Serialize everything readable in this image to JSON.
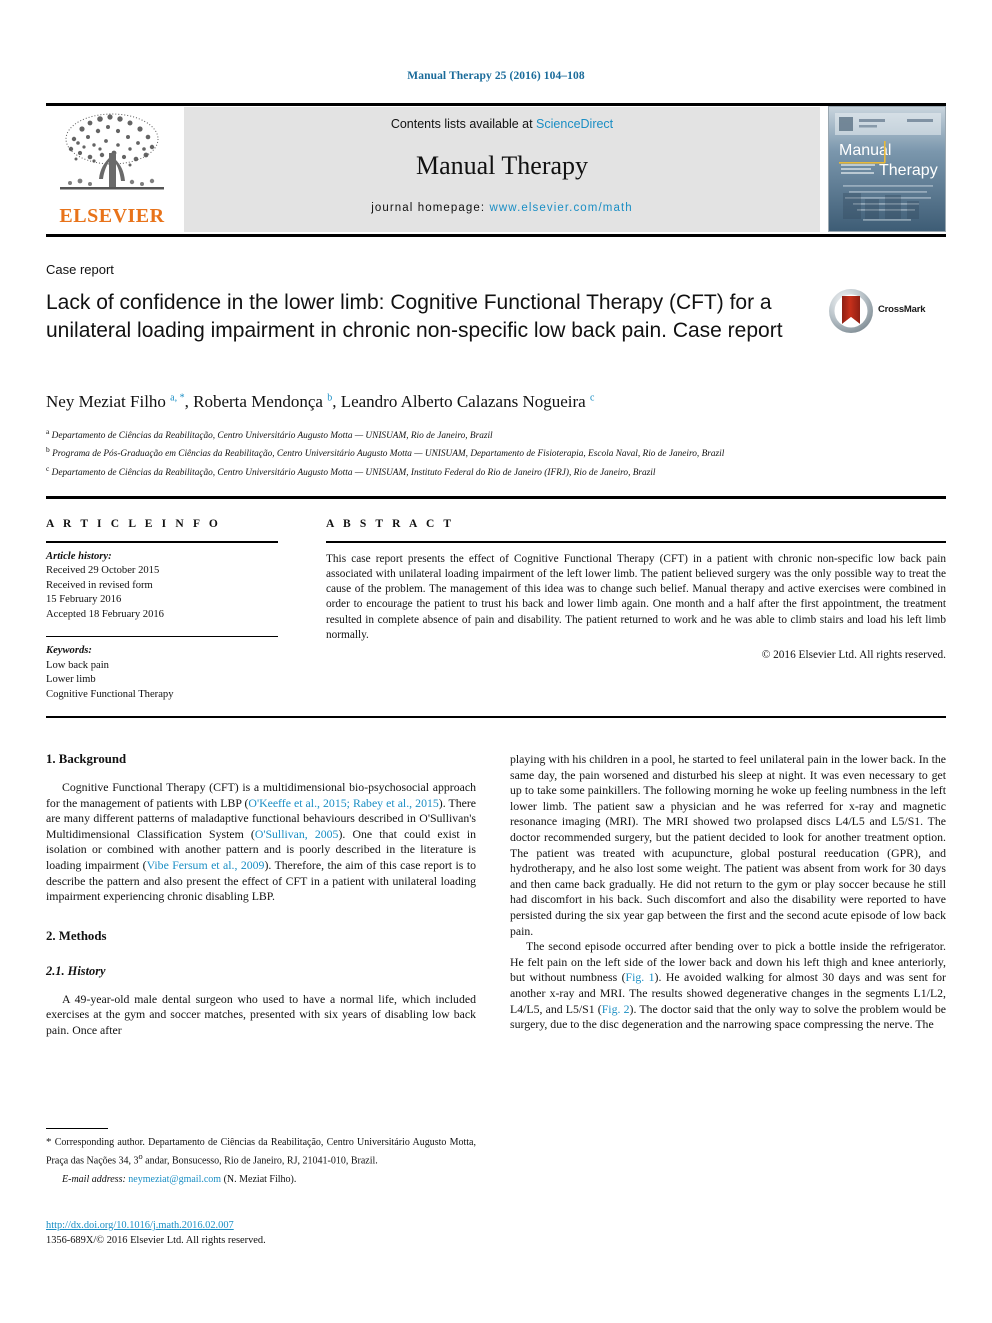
{
  "running_head": "Manual Therapy 25 (2016) 104–108",
  "masthead": {
    "contents_prefix": "Contents lists available at ",
    "sciencedirect": "ScienceDirect",
    "journal_name": "Manual Therapy",
    "homepage_label": "journal homepage: ",
    "homepage_url": "www.elsevier.com/math",
    "publisher": "ELSEVIER",
    "cover_title_line1": "Manual",
    "cover_title_line2": "Therapy"
  },
  "article": {
    "type": "Case report",
    "title": "Lack of confidence in the lower limb: Cognitive Functional Therapy (CFT) for a unilateral loading impairment in chronic non-specific low back pain. Case report",
    "crossmark_label": "CrossMark",
    "authors_html": "Ney Meziat Filho <sup class=\"sup\">a, *</sup>, Roberta Mendonça <sup class=\"sup\">b</sup>, Leandro Alberto Calazans Nogueira <sup class=\"sup\">c</sup>",
    "affiliations": [
      {
        "mark": "a",
        "text": "Departamento de Ciências da Reabilitação, Centro Universitário Augusto Motta — UNISUAM, Rio de Janeiro, Brazil"
      },
      {
        "mark": "b",
        "text": "Programa de Pós-Graduação em Ciências da Reabilitação, Centro Universitário Augusto Motta — UNISUAM, Departamento de Fisioterapia, Escola Naval, Rio de Janeiro, Brazil"
      },
      {
        "mark": "c",
        "text": "Departamento de Ciências da Reabilitação, Centro Universitário Augusto Motta — UNISUAM, Instituto Federal do Rio de Janeiro (IFRJ), Rio de Janeiro, Brazil"
      }
    ]
  },
  "article_info": {
    "heading": "A R T I C L E   I N F O",
    "history_label": "Article history:",
    "history": [
      "Received 29 October 2015",
      "Received in revised form",
      "15 February 2016",
      "Accepted 18 February 2016"
    ],
    "keywords_label": "Keywords:",
    "keywords": [
      "Low back pain",
      "Lower limb",
      "Cognitive Functional Therapy"
    ]
  },
  "abstract": {
    "heading": "A B S T R A C T",
    "text": "This case report presents the effect of Cognitive Functional Therapy (CFT) in a patient with chronic non-specific low back pain associated with unilateral loading impairment of the left lower limb. The patient believed surgery was the only possible way to treat the cause of the problem. The management of this idea was to change such belief. Manual therapy and active exercises were combined in order to encourage the patient to trust his back and lower limb again. One month and a half after the first appointment, the treatment resulted in complete absence of pain and disability. The patient returned to work and he was able to climb stairs and load his left limb normally.",
    "copyright": "© 2016 Elsevier Ltd. All rights reserved."
  },
  "body": {
    "background_heading": "1. Background",
    "background_p1_html": "Cognitive Functional Therapy (CFT) is a multidimensional bio-psychosocial approach for the management of patients with LBP (<span class=\"ref\">O'Keeffe et al., 2015; Rabey et al., 2015</span>). There are many different patterns of maladaptive functional behaviours described in O'Sullivan's Multidimensional Classification System (<span class=\"ref\">O'Sullivan, 2005</span>). One that could exist in isolation or combined with another pattern and is poorly described in the literature is loading impairment (<span class=\"ref\">Vibe Fersum et al., 2009</span>). Therefore, the aim of this case report is to describe the pattern and also present the effect of CFT in a patient with unilateral loading impairment experiencing chronic disabling LBP.",
    "methods_heading": "2. Methods",
    "history_heading": "2.1. History",
    "history_p1": "A 49-year-old male dental surgeon who used to have a normal life, which included exercises at the gym and soccer matches, presented with six years of disabling low back pain. Once after",
    "right_p1": "playing with his children in a pool, he started to feel unilateral pain in the lower back. In the same day, the pain worsened and disturbed his sleep at night. It was even necessary to get up to take some painkillers. The following morning he woke up feeling numbness in the left lower limb. The patient saw a physician and he was referred for x-ray and magnetic resonance imaging (MRI). The MRI showed two prolapsed discs L4/L5 and L5/S1. The doctor recommended surgery, but the patient decided to look for another treatment option. The patient was treated with acupuncture, global postural reeducation (GPR), and hydrotherapy, and he also lost some weight. The patient was absent from work for 30 days and then came back gradually. He did not return to the gym or play soccer because he still had discomfort in his back. Such discomfort and also the disability were reported to have persisted during the six year gap between the first and the second acute episode of low back pain.",
    "right_p2_html": "The second episode occurred after bending over to pick a bottle inside the refrigerator. He felt pain on the left side of the lower back and down his left thigh and knee anteriorly, but without numbness (<span class=\"ref\">Fig. 1</span>). He avoided walking for almost 30 days and was sent for another x-ray and MRI. The results showed degenerative changes in the segments L1/L2, L4/L5, and L5/S1 (<span class=\"ref\">Fig. 2</span>). The doctor said that the only way to solve the problem would be surgery, due to the disc degeneration and the narrowing space compressing the nerve. The"
  },
  "footnotes": {
    "corresponding_html": "<span class=\"star\">*</span> Corresponding author. Departamento de Ciências da Reabilitação, Centro Universitário Augusto Motta, Praça das Nações 34, 3<sup>o</sup> andar, Bonsucesso, Rio de Janeiro, RJ, 21041-010, Brazil.",
    "email_label": "E-mail address:",
    "email": "neymeziat@gmail.com",
    "email_owner": "(N. Meziat Filho).",
    "doi": "http://dx.doi.org/10.1016/j.math.2016.02.007",
    "issn": "1356-689X/© 2016 Elsevier Ltd. All rights reserved."
  },
  "colors": {
    "link": "#1a8ec4",
    "running_head": "#1a6b9a",
    "elsevier_orange": "#e8731a",
    "band_grey": "#e3e3e3"
  }
}
